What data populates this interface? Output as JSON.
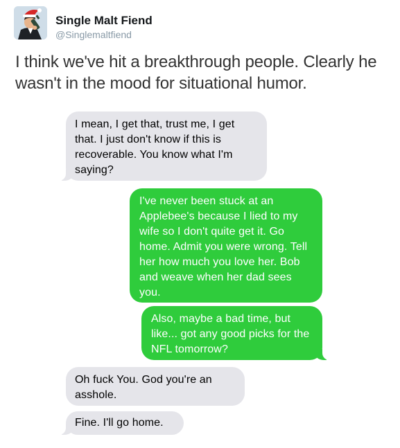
{
  "tweet": {
    "author_name": "Single Malt Fiend",
    "author_handle": "@Singlemaltfiend",
    "text": "I think we've hit a breakthrough people. Clearly he wasn't in the mood for situational humor."
  },
  "conversation": {
    "messages": [
      {
        "direction": "incoming",
        "text": "I mean, I get that, trust me, I get that. I just don't know if this is recoverable. You know what I'm saying?"
      },
      {
        "direction": "outgoing",
        "text": "I've never been stuck at an Applebee's because I lied to my wife so I don't quite get it. Go home. Admit you were wrong. Tell her how much you love her. Bob and weave when her dad sees you."
      },
      {
        "direction": "outgoing",
        "text": "Also, maybe a bad time, but like... got any good picks for the NFL tomorrow?"
      },
      {
        "direction": "incoming",
        "text": "Oh fuck You. God you're an asshole."
      },
      {
        "direction": "incoming",
        "text": "Fine. I'll go home."
      }
    ]
  },
  "colors": {
    "incoming_bubble": "#e5e5ea",
    "outgoing_bubble": "#2fcc3c",
    "handle_text": "#8899a6"
  },
  "icons": {
    "avatar": "cartoon-man-santa-hat-drinking-avatar"
  }
}
